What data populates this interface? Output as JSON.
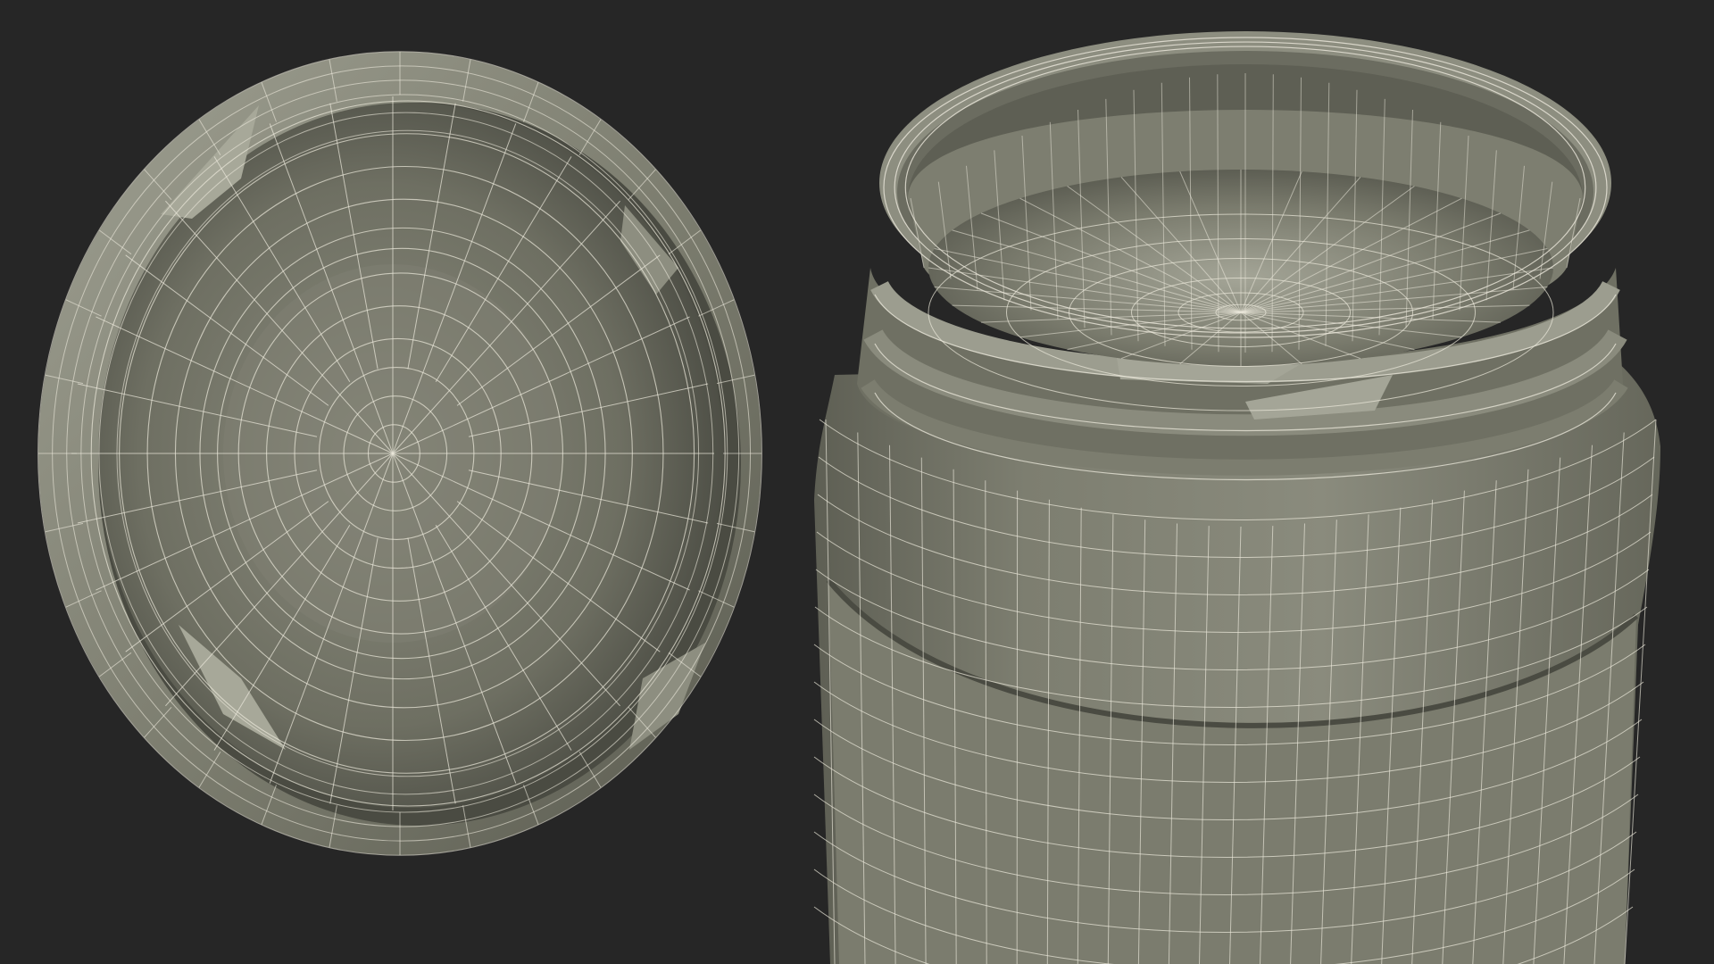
{
  "scene": {
    "background_color": "#262626",
    "surface_color": "#7a7b6d",
    "surface_dark_color": "#5c5d52",
    "surface_light_color": "#9a9b8d",
    "wire_color": "#ece9dc",
    "objects": [
      {
        "name": "lid",
        "view": "underside",
        "segments": 32
      },
      {
        "name": "jar",
        "view": "open-top",
        "segments": 32
      }
    ]
  }
}
